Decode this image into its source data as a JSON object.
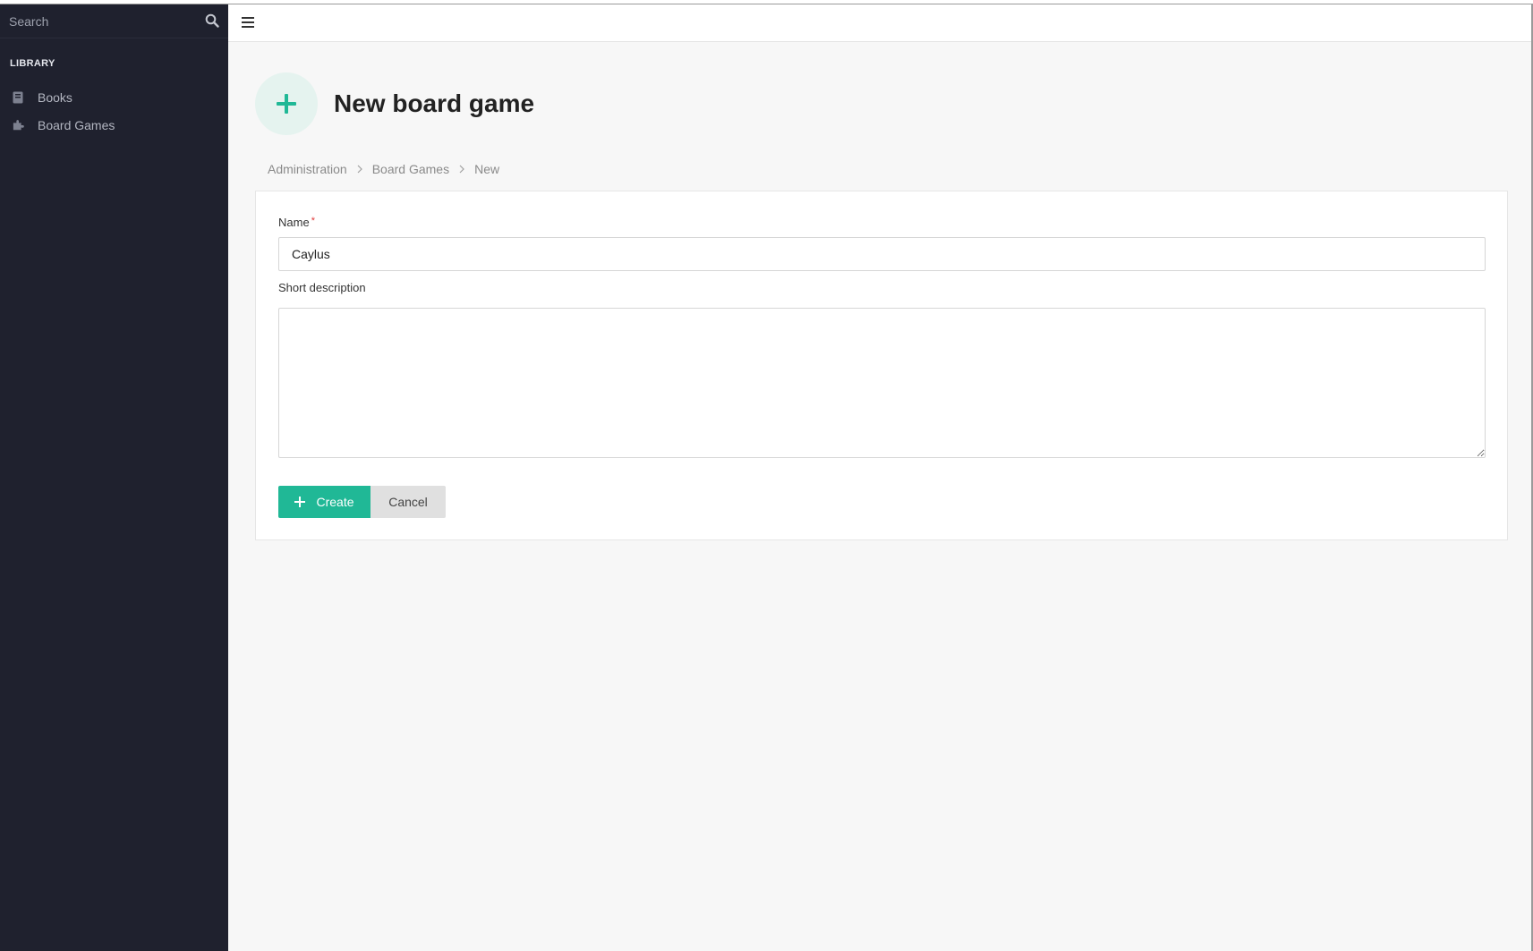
{
  "sidebar": {
    "search_placeholder": "Search",
    "section_title": "LIBRARY",
    "items": [
      {
        "label": "Books",
        "icon": "book-icon"
      },
      {
        "label": "Board Games",
        "icon": "puzzle-icon"
      }
    ]
  },
  "header": {
    "title": "New board game",
    "icon": "plus-icon",
    "accent_color": "#20b896"
  },
  "breadcrumb": [
    "Administration",
    "Board Games",
    "New"
  ],
  "form": {
    "name_label": "Name",
    "name_required_mark": "*",
    "name_value": "Caylus",
    "description_label": "Short description",
    "description_value": "",
    "create_label": "Create",
    "cancel_label": "Cancel"
  }
}
